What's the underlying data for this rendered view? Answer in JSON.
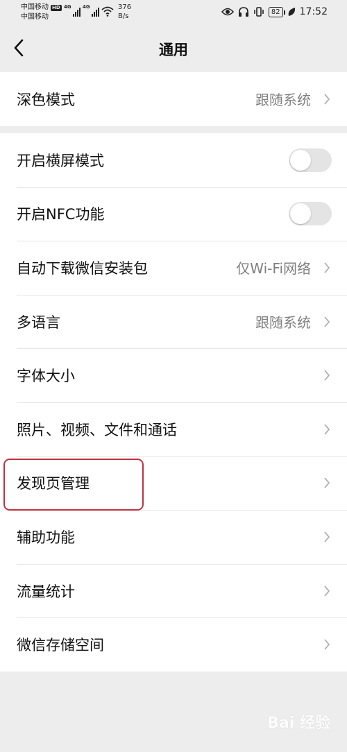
{
  "status_bar": {
    "carrier1": "中国移动",
    "hd": "HD",
    "carrier2": "中国移动",
    "sig1": "4G",
    "sig2": "4G",
    "net_speed": "376",
    "net_unit": "B/s",
    "battery": "82",
    "time": "17:52"
  },
  "nav": {
    "title": "通用"
  },
  "groups": {
    "g1": [
      {
        "label": "深色模式",
        "value": "跟随系统"
      }
    ],
    "g2": [
      {
        "label": "开启横屏模式",
        "toggle": false
      },
      {
        "label": "开启NFC功能",
        "toggle": false
      },
      {
        "label": "自动下载微信安装包",
        "value": "仅Wi-Fi网络"
      },
      {
        "label": "多语言",
        "value": "跟随系统"
      },
      {
        "label": "字体大小"
      },
      {
        "label": "照片、视频、文件和通话"
      },
      {
        "label": "发现页管理"
      },
      {
        "label": "辅助功能"
      },
      {
        "label": "流量统计"
      },
      {
        "label": "微信存储空间"
      }
    ]
  },
  "colors": {
    "highlight": "#c0313f",
    "background": "#ededed"
  },
  "watermark": "Bai 经验"
}
